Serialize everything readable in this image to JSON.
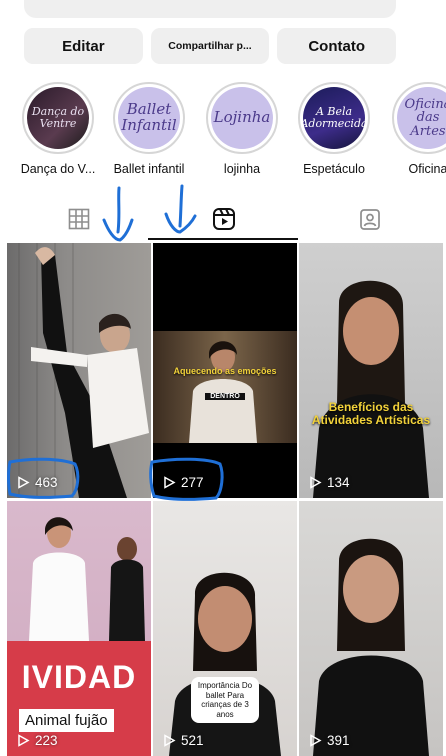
{
  "profile_actions": {
    "edit": "Editar",
    "share": "Compartilhar p...",
    "contact": "Contato"
  },
  "highlights": [
    {
      "label": "Dança do V...",
      "cover_text": "Dança do Ventre"
    },
    {
      "label": "Ballet infantil",
      "cover_text": "Ballet Infantil"
    },
    {
      "label": "lojinha",
      "cover_text": "Lojinha"
    },
    {
      "label": "Espetáculo",
      "cover_text": "A Bela Adormecida"
    },
    {
      "label": "Oficina",
      "cover_text": "Oficina das Artes"
    }
  ],
  "tabs": {
    "grid": "grid-icon",
    "reels": "reels-icon",
    "tagged": "tagged-icon",
    "active": "reels"
  },
  "reels": [
    {
      "views": "463",
      "caption": ""
    },
    {
      "views": "277",
      "caption": "Aquecendo as emoções",
      "sub_caption": "DENTRO"
    },
    {
      "views": "134",
      "caption": "Benefícios das Atividades Artísticas"
    },
    {
      "views": "223",
      "caption": "IVIDAD",
      "sub_caption": "Animal fujão"
    },
    {
      "views": "521",
      "caption": "Importância Do ballet Para crianças de 3 anos"
    },
    {
      "views": "391",
      "caption": ""
    }
  ],
  "colors": {
    "button_bg": "#efefef",
    "annotation_blue": "#1f6fd6"
  }
}
